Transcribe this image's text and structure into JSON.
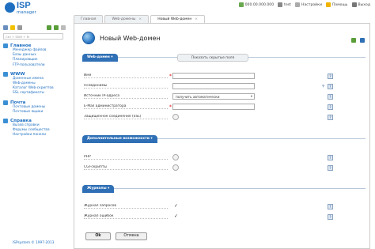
{
  "app": {
    "name": "ISP",
    "sub": "manager"
  },
  "topbar": {
    "balance": "000.00.000.000",
    "user": "test",
    "settings": "Настройки",
    "help": "Помощь",
    "logout": "Выход"
  },
  "tabs": [
    "Главная",
    "Web-домены",
    "Новый Web-домен"
  ],
  "sidebar": {
    "search_placeholder": "Ctrl + Shift + M",
    "groups": [
      {
        "title": "Главное",
        "items": [
          "Менеджер файлов",
          "Базы данных",
          "Планировщик",
          "FTP-пользователи"
        ]
      },
      {
        "title": "WWW",
        "items": [
          "Доменные имена",
          "Web-домены",
          "Каталог Web-скриптов",
          "SSL сертификаты"
        ]
      },
      {
        "title": "Почта",
        "items": [
          "Почтовые домены",
          "Почтовые ящики"
        ]
      },
      {
        "title": "Справка",
        "items": [
          "Вызов справки",
          "Форумы сообщества",
          "Настройки панели"
        ]
      }
    ],
    "footer": "ISPsystem © 1997-2013"
  },
  "page": {
    "title": "Новый Web-домен"
  },
  "sections": {
    "web": "Web-домен",
    "hidden_fields_btn": "Показать скрытые поля",
    "extra": "Дополнительные возможности",
    "logs": "Журналы"
  },
  "fields": {
    "name": {
      "label": "Имя",
      "value": ""
    },
    "aliases": {
      "label": "Псевдонимы",
      "value": ""
    },
    "ip": {
      "label": "Источник IP-адреса",
      "value": "получить автоматически"
    },
    "email": {
      "label": "E-Mail администратора",
      "value": ""
    },
    "ssl": {
      "label": "Защищенное соединение (SSL)"
    },
    "php": {
      "label": "PHP"
    },
    "cgi": {
      "label": "CGI-скрипты"
    },
    "access_log": {
      "label": "Журнал запросов"
    },
    "error_log": {
      "label": "Журнал ошибок"
    }
  },
  "help_glyph": "?",
  "check_glyph": "✓",
  "buttons": {
    "ok": "Ok",
    "cancel": "Отмена"
  },
  "colors": {
    "accent": "#1f6fc0",
    "section": "#2f6fb5",
    "required": "#dd0000"
  }
}
